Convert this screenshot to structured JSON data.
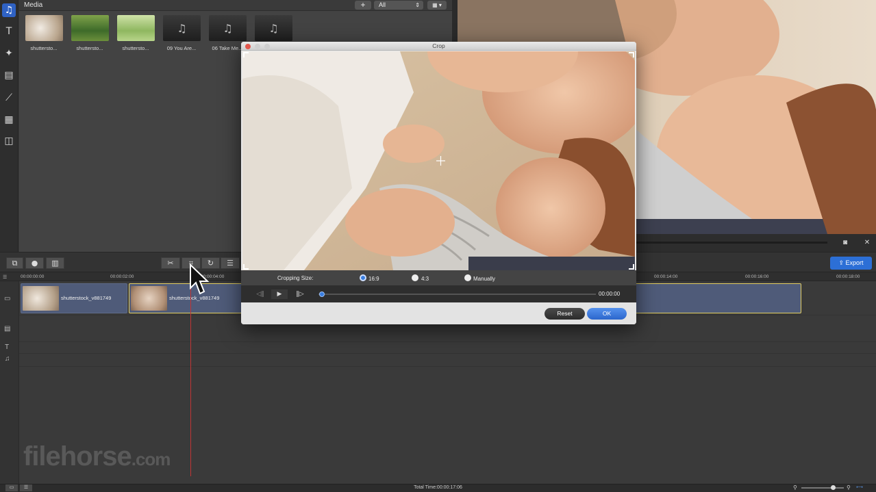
{
  "colors": {
    "accent": "#2c6fd6",
    "playhead": "#c23535",
    "clip": "#4f5b79"
  },
  "rail": {
    "items": [
      {
        "name": "media-icon",
        "glyph": "▣"
      },
      {
        "name": "text-icon",
        "glyph": "T"
      },
      {
        "name": "filters-icon",
        "glyph": "✦"
      },
      {
        "name": "overlays-icon",
        "glyph": "▤"
      },
      {
        "name": "transitions-icon",
        "glyph": "⟋"
      },
      {
        "name": "elements-icon",
        "glyph": "▦"
      },
      {
        "name": "split-screen-icon",
        "glyph": "◫"
      }
    ]
  },
  "media": {
    "title": "Media",
    "add": "+",
    "filter": "All",
    "items": [
      {
        "label": "shutterstо...",
        "kind": "video"
      },
      {
        "label": "shutterstо...",
        "kind": "video"
      },
      {
        "label": "shutterstо...",
        "kind": "video"
      },
      {
        "label": "09 You Are...",
        "kind": "audio"
      },
      {
        "label": "06 Take Me...",
        "kind": "audio"
      },
      {
        "label": "",
        "kind": "audio"
      }
    ]
  },
  "toolbar": {
    "export": "Export"
  },
  "ruler": {
    "ticks": [
      "00:00:00:00",
      "00:00:02:00",
      "00:00:04:00",
      "00:00:14:00",
      "00:00:16:00",
      "00:00:18:00"
    ]
  },
  "timeline": {
    "clips": [
      {
        "label": "shutterstock_v881749"
      },
      {
        "label": "shutterstock_v881749"
      }
    ]
  },
  "crop_dialog": {
    "title": "Crop",
    "cropping_size_label": "Cropping Size:",
    "options": [
      "16:9",
      "4:3",
      "Manually"
    ],
    "selected_option": "16:9",
    "time": "00:00:00",
    "reset": "Reset",
    "ok": "OK"
  },
  "status": {
    "total_time": "Total Time:00:00:17:06"
  },
  "watermark": {
    "main": "filehorse",
    "suffix": ".com"
  }
}
